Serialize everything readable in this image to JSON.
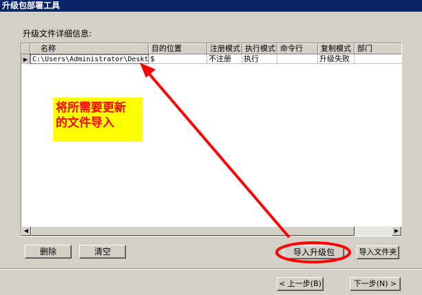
{
  "window": {
    "title": "升级包部署工具"
  },
  "section_label": "升级文件详细信息:",
  "grid": {
    "columns": [
      "名称",
      "目的位置",
      "注册模式",
      "执行模式",
      "命令行",
      "复制模式",
      "部门"
    ],
    "rows": [
      {
        "indicator": "▶",
        "name": "C:\\Users\\Administrator\\Deskto...",
        "dest": "$",
        "register": "不注册",
        "exec": "执行",
        "cmd": "",
        "copy": "升级失败",
        "dept": ""
      }
    ]
  },
  "buttons": {
    "delete": "删除",
    "clear": "清空",
    "import_package": "导入升级包",
    "import_folder": "导入文件夹",
    "prev": "< 上一步(B)",
    "next": "下一步(N) >"
  },
  "annotation": {
    "line1": "将所需要更新",
    "line2": "的文件导入",
    "color": "#ff0000",
    "bg": "#ffff00"
  },
  "colors": {
    "titlebar": "#0a246a",
    "dialog_bg": "#d4d0c8"
  }
}
